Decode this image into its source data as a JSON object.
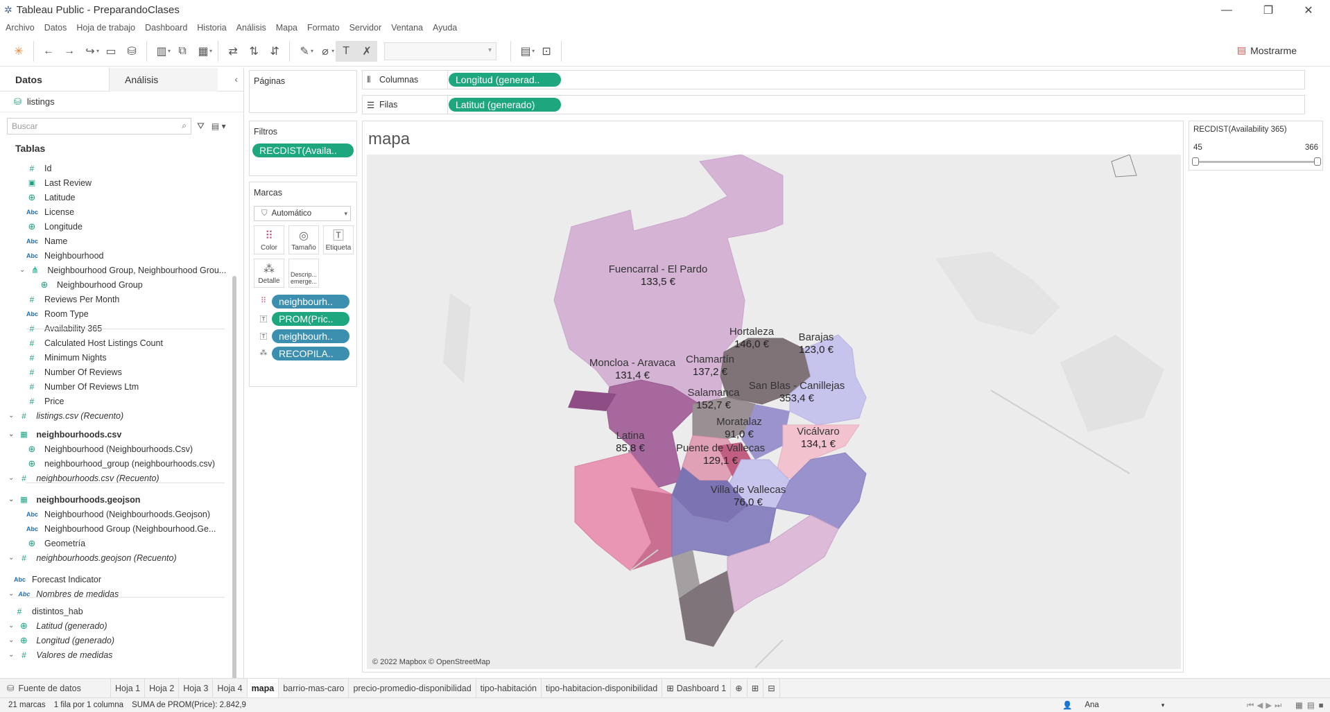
{
  "window": {
    "title": "Tableau Public - PreparandoClases"
  },
  "menu": [
    "Archivo",
    "Datos",
    "Hoja de trabajo",
    "Dashboard",
    "Historia",
    "Análisis",
    "Mapa",
    "Formato",
    "Servidor",
    "Ventana",
    "Ayuda"
  ],
  "toolbar": {
    "show_me_label": "Mostrarme"
  },
  "left_pane": {
    "tabs": [
      "Datos",
      "Análisis"
    ],
    "data_source": "listings",
    "search_placeholder": "Buscar",
    "tables_header": "Tablas",
    "fields": [
      {
        "icon": "#",
        "label": "Id"
      },
      {
        "icon": "cal",
        "label": "Last Review"
      },
      {
        "icon": "geo",
        "label": "Latitude"
      },
      {
        "icon": "Abc",
        "label": "License"
      },
      {
        "icon": "geo",
        "label": "Longitude"
      },
      {
        "icon": "Abc",
        "label": "Name"
      },
      {
        "icon": "Abc",
        "label": "Neighbourhood"
      },
      {
        "icon": "hier",
        "label": "Neighbourhood Group, Neighbourhood Grou..."
      },
      {
        "icon": "geo",
        "label": "Neighbourhood Group"
      },
      {
        "icon": "#",
        "label": "Reviews Per Month"
      },
      {
        "icon": "Abc",
        "label": "Room Type"
      },
      {
        "icon": "#",
        "label": "Availability 365"
      },
      {
        "icon": "#",
        "label": "Calculated Host Listings Count"
      },
      {
        "icon": "#",
        "label": "Minimum Nights"
      },
      {
        "icon": "#",
        "label": "Number Of Reviews"
      },
      {
        "icon": "#",
        "label": "Number Of Reviews Ltm"
      },
      {
        "icon": "#",
        "label": "Price"
      },
      {
        "icon": "#",
        "label": "listings.csv (Recuento)"
      },
      {
        "icon": "table",
        "label": "neighbourhoods.csv"
      },
      {
        "icon": "geo",
        "label": "Neighbourhood (Neighbourhoods.Csv)"
      },
      {
        "icon": "geo",
        "label": "neighbourhood_group (neighbourhoods.csv)"
      },
      {
        "icon": "#",
        "label": "neighbourhoods.csv (Recuento)"
      },
      {
        "icon": "table",
        "label": "neighbourhoods.geojson"
      },
      {
        "icon": "Abc",
        "label": "Neighbourhood (Neighbourhoods.Geojson)"
      },
      {
        "icon": "Abc",
        "label": "Neighbourhood Group (Neighbourhood.Ge..."
      },
      {
        "icon": "geo",
        "label": "Geometría"
      },
      {
        "icon": "#",
        "label": "neighbourhoods.geojson (Recuento)"
      },
      {
        "icon": "Abc",
        "label": "Forecast Indicator"
      },
      {
        "icon": "Abc",
        "label": "Nombres de medidas"
      },
      {
        "icon": "#",
        "label": "distintos_hab"
      },
      {
        "icon": "geo",
        "label": "Latitud (generado)"
      },
      {
        "icon": "geo",
        "label": "Longitud (generado)"
      },
      {
        "icon": "#",
        "label": "Valores de medidas"
      }
    ]
  },
  "pages": {
    "title": "Páginas"
  },
  "filters": {
    "title": "Filtros",
    "pill": "RECDIST(Availa.."
  },
  "marks": {
    "title": "Marcas",
    "mark_type": "Automático",
    "buttons": [
      "Color",
      "Tamaño",
      "Etiqueta",
      "Detalle",
      "Descrip... emerge..."
    ],
    "pills": [
      "neighbourh..",
      "PROM(Pric..",
      "neighbourh..",
      "RECOPILA.."
    ]
  },
  "columns": {
    "label": "Columnas",
    "pill": "Longitud (generad.."
  },
  "rows": {
    "label": "Filas",
    "pill": "Latitud (generado)"
  },
  "view": {
    "title": "mapa",
    "attribution": "© 2022 Mapbox © OpenStreetMap",
    "districts": [
      {
        "name": "Fuencarral - El Pardo",
        "value": "133,5 €"
      },
      {
        "name": "Hortaleza",
        "value": "146,0 €"
      },
      {
        "name": "Barajas",
        "value": "123,0 €"
      },
      {
        "name": "Chamartín",
        "value": "137,2 €"
      },
      {
        "name": "Moncloa - Aravaca",
        "value": "131,4 €"
      },
      {
        "name": "Salamanca",
        "value": "152,7 €"
      },
      {
        "name": "San Blas - Canillejas",
        "value": "353,4 €"
      },
      {
        "name": "Moratalaz",
        "value": "91,0 €"
      },
      {
        "name": "Latina",
        "value": "85,8 €"
      },
      {
        "name": "Vicálvaro",
        "value": "134,1 €"
      },
      {
        "name": "Puente de Vallecas",
        "value": "129,1 €"
      },
      {
        "name": "Villa de Vallecas",
        "value": "76,0 €"
      }
    ]
  },
  "range_filter": {
    "title": "RECDIST(Availability 365)",
    "min": "45",
    "max": "366"
  },
  "sheet_tabs": [
    "Fuente de datos",
    "Hoja 1",
    "Hoja 2",
    "Hoja 3",
    "Hoja 4",
    "mapa",
    "barrio-mas-caro",
    "precio-promedio-disponibilidad",
    "tipo-habitación",
    "tipo-habitacion-disponibilidad",
    "Dashboard 1"
  ],
  "status": {
    "marks": "21 marcas",
    "rows": "1 fila por 1 columna",
    "sum": "SUMA de PROM(Price): 2.842,9",
    "user": "Ana"
  }
}
